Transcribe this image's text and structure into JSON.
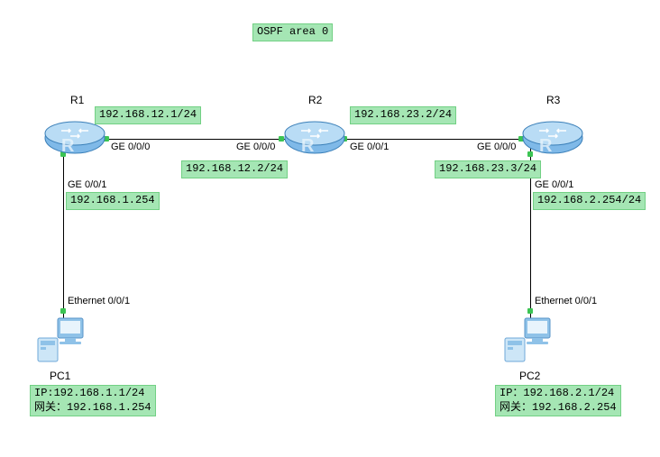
{
  "title": "OSPF area 0",
  "routers": {
    "r1": {
      "name": "R1"
    },
    "r2": {
      "name": "R2"
    },
    "r3": {
      "name": "R3"
    }
  },
  "pcs": {
    "pc1": {
      "name": "PC1",
      "ip_line": "IP:192.168.1.1/24",
      "gw_line": "网关：192.168.1.254"
    },
    "pc2": {
      "name": "PC2",
      "ip_line": "IP：192.168.2.1/24",
      "gw_line": "网关：192.168.2.254"
    }
  },
  "ip_labels": {
    "r1_ge000": "192.168.12.1/24",
    "r2_ge000": "192.168.12.2/24",
    "r2_ge001": "192.168.23.2/24",
    "r3_ge000": "192.168.23.3/24",
    "r1_ge001": "192.168.1.254",
    "r3_ge001": "192.168.2.254/24"
  },
  "port_labels": {
    "r1_right": "GE 0/0/0",
    "r2_left": "GE 0/0/0",
    "r2_right": "GE 0/0/1",
    "r3_left": "GE 0/0/0",
    "r1_down": "GE 0/0/1",
    "r3_down": "GE 0/0/1",
    "pc1_up": "Ethernet 0/0/1",
    "pc2_up": "Ethernet 0/0/1"
  },
  "chart_data": {
    "type": "network-topology",
    "title": "OSPF area 0",
    "nodes": [
      {
        "id": "R1",
        "type": "router"
      },
      {
        "id": "R2",
        "type": "router"
      },
      {
        "id": "R3",
        "type": "router"
      },
      {
        "id": "PC1",
        "type": "pc",
        "ip": "192.168.1.1/24",
        "gateway": "192.168.1.254"
      },
      {
        "id": "PC2",
        "type": "pc",
        "ip": "192.168.2.1/24",
        "gateway": "192.168.2.254"
      }
    ],
    "links": [
      {
        "endpoints": [
          {
            "node": "R1",
            "port": "GE 0/0/0",
            "ip": "192.168.12.1/24"
          },
          {
            "node": "R2",
            "port": "GE 0/0/0",
            "ip": "192.168.12.2/24"
          }
        ]
      },
      {
        "endpoints": [
          {
            "node": "R2",
            "port": "GE 0/0/1",
            "ip": "192.168.23.2/24"
          },
          {
            "node": "R3",
            "port": "GE 0/0/0",
            "ip": "192.168.23.3/24"
          }
        ]
      },
      {
        "endpoints": [
          {
            "node": "R1",
            "port": "GE 0/0/1",
            "ip": "192.168.1.254"
          },
          {
            "node": "PC1",
            "port": "Ethernet 0/0/1"
          }
        ]
      },
      {
        "endpoints": [
          {
            "node": "R3",
            "port": "GE 0/0/1",
            "ip": "192.168.2.254/24"
          },
          {
            "node": "PC2",
            "port": "Ethernet 0/0/1"
          }
        ]
      }
    ]
  }
}
